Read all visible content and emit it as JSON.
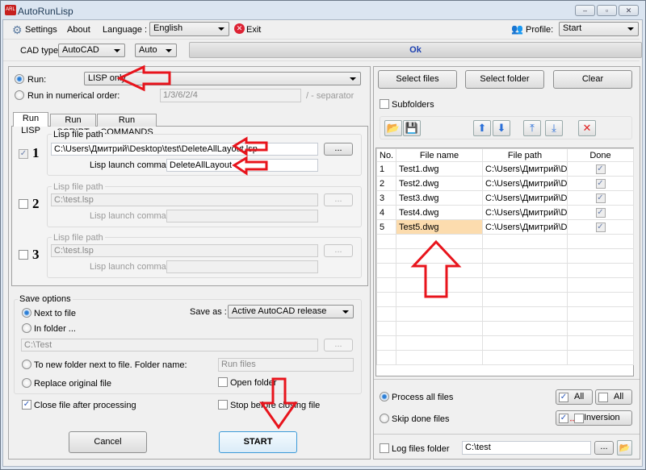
{
  "window": {
    "title": "AutoRunLisp",
    "min": "–",
    "max": "▫",
    "close": "✕"
  },
  "menu": {
    "settings": "Settings",
    "about": "About",
    "language_label": "Language :",
    "language_value": "English",
    "exit": "Exit",
    "profile_label": "Profile:",
    "profile_value": "Start"
  },
  "cad": {
    "label": "CAD type:",
    "type_value": "AutoCAD",
    "version_value": "Auto",
    "progress_text": "Ok"
  },
  "run": {
    "run_label": "Run:",
    "run_value": "LISP only",
    "numerical_label": "Run in numerical order:",
    "numerical_value": "1/3/6/2/4",
    "separator_hint": "/ - separator"
  },
  "tabs": [
    "Run LISP",
    "Run SCRIPT",
    "Run COMMANDS"
  ],
  "lisp": [
    {
      "n": "1",
      "checked": true,
      "path_label": "Lisp file path",
      "path": "C:\\Users\\Дмитрий\\Desktop\\test\\DeleteAllLayout.lsp",
      "cmd_label": "Lisp launch command:",
      "cmd": "DeleteAllLayout",
      "browse": "..."
    },
    {
      "n": "2",
      "checked": false,
      "path_label": "Lisp file path",
      "path": "C:\\test.lsp",
      "cmd_label": "Lisp launch command:",
      "cmd": "",
      "browse": "..."
    },
    {
      "n": "3",
      "checked": false,
      "path_label": "Lisp file path",
      "path": "C:\\test.lsp",
      "cmd_label": "Lisp launch command:",
      "cmd": "",
      "browse": "..."
    }
  ],
  "save": {
    "title": "Save options",
    "next_to_file": "Next to file",
    "save_as_label": "Save as :",
    "save_as_value": "Active AutoCAD release",
    "in_folder": "In folder ...",
    "folder_value": "C:\\Test",
    "browse": "...",
    "new_folder": "To new folder next to file. Folder name:",
    "new_folder_value": "Run files",
    "replace": "Replace original file",
    "open_folder": "Open folder",
    "close_after": "Close file after processing",
    "stop_before": "Stop before closing file"
  },
  "actions": {
    "cancel": "Cancel",
    "start": "START"
  },
  "files": {
    "select_files": "Select files",
    "select_folder": "Select folder",
    "clear": "Clear",
    "subfolders": "Subfolders",
    "columns": [
      "No.",
      "File name",
      "File path",
      "Done"
    ],
    "rows": [
      {
        "no": "1",
        "name": "Test1.dwg",
        "path": "C:\\Users\\Дмитрий\\D...",
        "done": "✓"
      },
      {
        "no": "2",
        "name": "Test2.dwg",
        "path": "C:\\Users\\Дмитрий\\D...",
        "done": "✓"
      },
      {
        "no": "3",
        "name": "Test3.dwg",
        "path": "C:\\Users\\Дмитрий\\D...",
        "done": "✓"
      },
      {
        "no": "4",
        "name": "Test4.dwg",
        "path": "C:\\Users\\Дмитрий\\D...",
        "done": "✓"
      },
      {
        "no": "5",
        "name": "Test5.dwg",
        "path": "C:\\Users\\Дмитрий\\D...",
        "done": "✓"
      }
    ],
    "process_all": "Process all files",
    "skip_done": "Skip done files",
    "all_on": "All",
    "all_off": "All",
    "inversion": "Inversion",
    "log_label": "Log files folder",
    "log_value": "C:\\test",
    "browse": "..."
  },
  "colors": {
    "selected_cell": "#fcdcae",
    "annotation": "#e8141c",
    "progress_text": "#1b3fb0"
  }
}
